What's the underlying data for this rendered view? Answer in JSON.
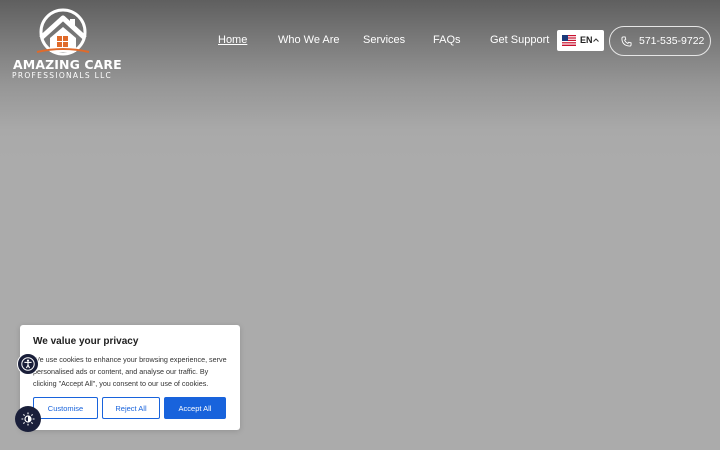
{
  "brand": {
    "name_line1": "AMAZING CARE",
    "name_line2": "PROFESSIONALS LLC"
  },
  "nav": {
    "items": [
      {
        "label": "Home",
        "active": true
      },
      {
        "label": "Who We Are",
        "active": false
      },
      {
        "label": "Services",
        "active": false
      },
      {
        "label": "FAQs",
        "active": false
      },
      {
        "label": "Get Support",
        "active": false
      }
    ]
  },
  "language": {
    "code": "EN",
    "flag_icon": "us-flag-icon"
  },
  "phone": {
    "number": "571-535-9722",
    "icon": "phone-icon"
  },
  "cookie_banner": {
    "title": "We value your privacy",
    "text": "We use cookies to enhance your browsing experience, serve personalised ads or content, and analyse our traffic. By clicking \"Accept All\", you consent to our use of cookies.",
    "customise_label": "Customise",
    "reject_label": "Reject All",
    "accept_label": "Accept All"
  },
  "widgets": {
    "accessibility_icon": "accessibility-icon",
    "contrast_icon": "contrast-toggle-icon"
  },
  "colors": {
    "accent": "#1863dc",
    "widget_bg": "#1a1f3a",
    "hero_bg": "#ababab"
  }
}
